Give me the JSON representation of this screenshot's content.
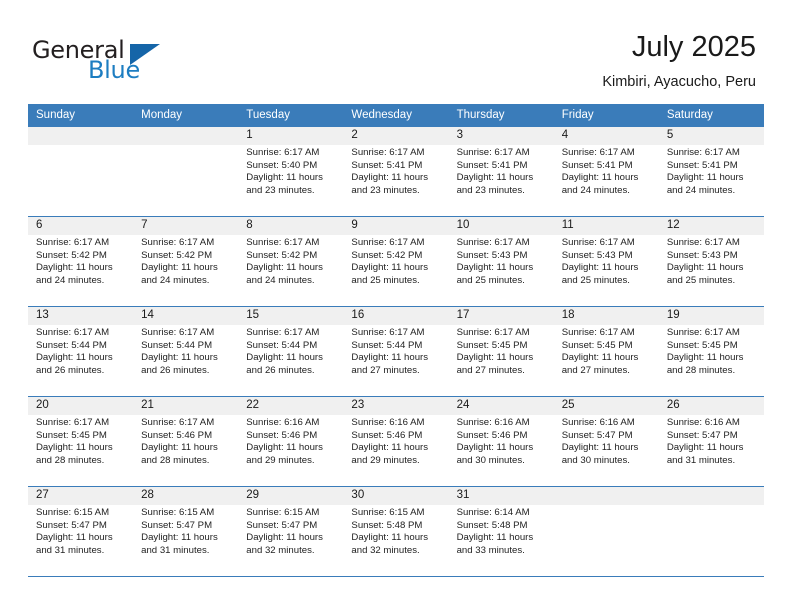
{
  "brand": {
    "word_one": "General",
    "word_two": "Blue",
    "triangle_icon": "triangle-icon",
    "accent_color": "#1d7dc1"
  },
  "header": {
    "title": "July 2025",
    "subtitle": "Kimbiri, Ayacucho, Peru"
  },
  "calendar": {
    "header_bg": "#3a7cba",
    "daynum_band_bg": "#f0f0f0",
    "day_headers": [
      "Sunday",
      "Monday",
      "Tuesday",
      "Wednesday",
      "Thursday",
      "Friday",
      "Saturday"
    ],
    "weeks": [
      [
        {
          "day": "",
          "info": ""
        },
        {
          "day": "",
          "info": ""
        },
        {
          "day": "1",
          "info": "Sunrise: 6:17 AM\nSunset: 5:40 PM\nDaylight: 11 hours\nand 23 minutes."
        },
        {
          "day": "2",
          "info": "Sunrise: 6:17 AM\nSunset: 5:41 PM\nDaylight: 11 hours\nand 23 minutes."
        },
        {
          "day": "3",
          "info": "Sunrise: 6:17 AM\nSunset: 5:41 PM\nDaylight: 11 hours\nand 23 minutes."
        },
        {
          "day": "4",
          "info": "Sunrise: 6:17 AM\nSunset: 5:41 PM\nDaylight: 11 hours\nand 24 minutes."
        },
        {
          "day": "5",
          "info": "Sunrise: 6:17 AM\nSunset: 5:41 PM\nDaylight: 11 hours\nand 24 minutes."
        }
      ],
      [
        {
          "day": "6",
          "info": "Sunrise: 6:17 AM\nSunset: 5:42 PM\nDaylight: 11 hours\nand 24 minutes."
        },
        {
          "day": "7",
          "info": "Sunrise: 6:17 AM\nSunset: 5:42 PM\nDaylight: 11 hours\nand 24 minutes."
        },
        {
          "day": "8",
          "info": "Sunrise: 6:17 AM\nSunset: 5:42 PM\nDaylight: 11 hours\nand 24 minutes."
        },
        {
          "day": "9",
          "info": "Sunrise: 6:17 AM\nSunset: 5:42 PM\nDaylight: 11 hours\nand 25 minutes."
        },
        {
          "day": "10",
          "info": "Sunrise: 6:17 AM\nSunset: 5:43 PM\nDaylight: 11 hours\nand 25 minutes."
        },
        {
          "day": "11",
          "info": "Sunrise: 6:17 AM\nSunset: 5:43 PM\nDaylight: 11 hours\nand 25 minutes."
        },
        {
          "day": "12",
          "info": "Sunrise: 6:17 AM\nSunset: 5:43 PM\nDaylight: 11 hours\nand 25 minutes."
        }
      ],
      [
        {
          "day": "13",
          "info": "Sunrise: 6:17 AM\nSunset: 5:44 PM\nDaylight: 11 hours\nand 26 minutes."
        },
        {
          "day": "14",
          "info": "Sunrise: 6:17 AM\nSunset: 5:44 PM\nDaylight: 11 hours\nand 26 minutes."
        },
        {
          "day": "15",
          "info": "Sunrise: 6:17 AM\nSunset: 5:44 PM\nDaylight: 11 hours\nand 26 minutes."
        },
        {
          "day": "16",
          "info": "Sunrise: 6:17 AM\nSunset: 5:44 PM\nDaylight: 11 hours\nand 27 minutes."
        },
        {
          "day": "17",
          "info": "Sunrise: 6:17 AM\nSunset: 5:45 PM\nDaylight: 11 hours\nand 27 minutes."
        },
        {
          "day": "18",
          "info": "Sunrise: 6:17 AM\nSunset: 5:45 PM\nDaylight: 11 hours\nand 27 minutes."
        },
        {
          "day": "19",
          "info": "Sunrise: 6:17 AM\nSunset: 5:45 PM\nDaylight: 11 hours\nand 28 minutes."
        }
      ],
      [
        {
          "day": "20",
          "info": "Sunrise: 6:17 AM\nSunset: 5:45 PM\nDaylight: 11 hours\nand 28 minutes."
        },
        {
          "day": "21",
          "info": "Sunrise: 6:17 AM\nSunset: 5:46 PM\nDaylight: 11 hours\nand 28 minutes."
        },
        {
          "day": "22",
          "info": "Sunrise: 6:16 AM\nSunset: 5:46 PM\nDaylight: 11 hours\nand 29 minutes."
        },
        {
          "day": "23",
          "info": "Sunrise: 6:16 AM\nSunset: 5:46 PM\nDaylight: 11 hours\nand 29 minutes."
        },
        {
          "day": "24",
          "info": "Sunrise: 6:16 AM\nSunset: 5:46 PM\nDaylight: 11 hours\nand 30 minutes."
        },
        {
          "day": "25",
          "info": "Sunrise: 6:16 AM\nSunset: 5:47 PM\nDaylight: 11 hours\nand 30 minutes."
        },
        {
          "day": "26",
          "info": "Sunrise: 6:16 AM\nSunset: 5:47 PM\nDaylight: 11 hours\nand 31 minutes."
        }
      ],
      [
        {
          "day": "27",
          "info": "Sunrise: 6:15 AM\nSunset: 5:47 PM\nDaylight: 11 hours\nand 31 minutes."
        },
        {
          "day": "28",
          "info": "Sunrise: 6:15 AM\nSunset: 5:47 PM\nDaylight: 11 hours\nand 31 minutes."
        },
        {
          "day": "29",
          "info": "Sunrise: 6:15 AM\nSunset: 5:47 PM\nDaylight: 11 hours\nand 32 minutes."
        },
        {
          "day": "30",
          "info": "Sunrise: 6:15 AM\nSunset: 5:48 PM\nDaylight: 11 hours\nand 32 minutes."
        },
        {
          "day": "31",
          "info": "Sunrise: 6:14 AM\nSunset: 5:48 PM\nDaylight: 11 hours\nand 33 minutes."
        },
        {
          "day": "",
          "info": ""
        },
        {
          "day": "",
          "info": ""
        }
      ]
    ]
  }
}
